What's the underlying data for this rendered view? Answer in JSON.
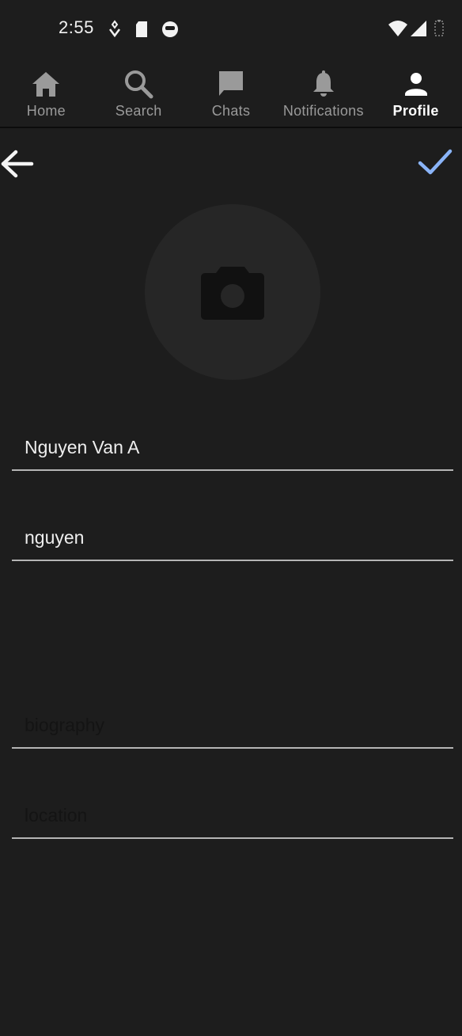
{
  "status_bar": {
    "time": "2:55",
    "icons": [
      "notification-app-icon",
      "sd-card-icon",
      "app-face-icon"
    ],
    "right_icons": [
      "wifi-icon",
      "cell-signal-icon",
      "battery-icon"
    ]
  },
  "nav": {
    "items": [
      {
        "label": "Home",
        "icon": "home-icon"
      },
      {
        "label": "Search",
        "icon": "search-icon"
      },
      {
        "label": "Chats",
        "icon": "chat-icon"
      },
      {
        "label": "Notifications",
        "icon": "bell-icon"
      },
      {
        "label": "Profile",
        "icon": "person-icon"
      }
    ],
    "active_index": 4
  },
  "app_bar": {
    "back_icon": "arrow-back-icon",
    "confirm_icon": "check-icon",
    "confirm_color": "#8ab4f8"
  },
  "avatar": {
    "icon": "camera-icon",
    "background": "#262626"
  },
  "form": {
    "name": {
      "value": "Nguyen Van A",
      "placeholder": ""
    },
    "username": {
      "value": "nguyen",
      "placeholder": ""
    },
    "biography": {
      "value": "",
      "placeholder": "biography"
    },
    "location": {
      "value": "",
      "placeholder": "location"
    }
  },
  "colors": {
    "background": "#1d1d1d",
    "nav_inactive": "#9a9a9a",
    "nav_active": "#ffffff",
    "accent": "#8ab4f8"
  }
}
